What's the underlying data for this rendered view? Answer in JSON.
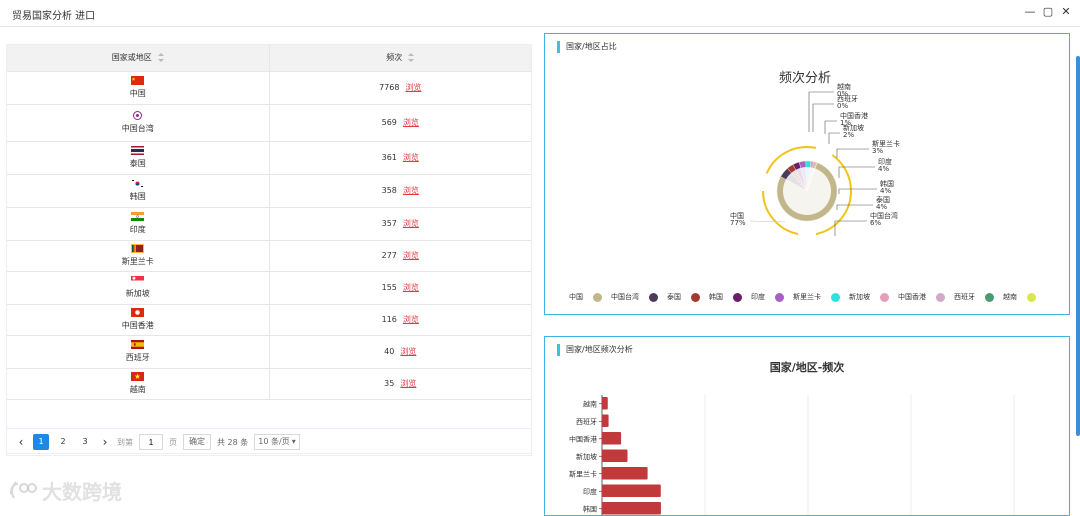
{
  "window": {
    "title": "贸易国家分析 进口"
  },
  "table": {
    "headers": [
      "国家或地区",
      "频次"
    ],
    "link_label": "浏览",
    "rows": [
      {
        "country": "中国",
        "count": "7768",
        "flag": "cn"
      },
      {
        "country": "中国台湾",
        "count": "569",
        "flag": "tw"
      },
      {
        "country": "泰国",
        "count": "361",
        "flag": "th"
      },
      {
        "country": "韩国",
        "count": "358",
        "flag": "kr"
      },
      {
        "country": "印度",
        "count": "357",
        "flag": "in"
      },
      {
        "country": "斯里兰卡",
        "count": "277",
        "flag": "lk"
      },
      {
        "country": "新加坡",
        "count": "155",
        "flag": "sg"
      },
      {
        "country": "中国香港",
        "count": "116",
        "flag": "hk"
      },
      {
        "country": "西班牙",
        "count": "40",
        "flag": "es"
      },
      {
        "country": "越南",
        "count": "35",
        "flag": "vn"
      }
    ]
  },
  "pagination": {
    "pages": [
      "1",
      "2",
      "3"
    ],
    "current": "1",
    "goto_label": "到第",
    "page_input": "1",
    "page_unit": "页",
    "confirm_label": "确定",
    "total_label": "共 28 条",
    "page_size": "10 条/页"
  },
  "watermark": "大数跨境",
  "pie_panel": {
    "title": "国家/地区占比",
    "chart_title": "频次分析"
  },
  "bar_panel": {
    "title": "国家/地区频次分析",
    "chart_title": "国家/地区-频次"
  },
  "chart_data": [
    {
      "type": "pie",
      "title": "频次分析",
      "slices": [
        {
          "label": "中国",
          "percent": "77%",
          "value": 7768,
          "color": "#c2b78a"
        },
        {
          "label": "中国台湾",
          "percent": "6%",
          "value": 569,
          "color": "#4b3a5a"
        },
        {
          "label": "泰国",
          "percent": "4%",
          "value": 361,
          "color": "#a23a32"
        },
        {
          "label": "韩国",
          "percent": "4%",
          "value": 358,
          "color": "#6b1e6b"
        },
        {
          "label": "印度",
          "percent": "4%",
          "value": 357,
          "color": "#a660c8"
        },
        {
          "label": "斯里兰卡",
          "percent": "3%",
          "value": 277,
          "color": "#2fe0e0"
        },
        {
          "label": "新加坡",
          "percent": "2%",
          "value": 155,
          "color": "#e4a0b8"
        },
        {
          "label": "中国香港",
          "percent": "1%",
          "value": 116,
          "color": "#d0aac8"
        },
        {
          "label": "西班牙",
          "percent": "0%",
          "value": 40,
          "color": "#4c9a72"
        },
        {
          "label": "越南",
          "percent": "0%",
          "value": 35,
          "color": "#d8e84c"
        }
      ],
      "legend_position": "bottom"
    },
    {
      "type": "bar",
      "orientation": "horizontal",
      "title": "国家/地区-频次",
      "categories": [
        "越南",
        "西班牙",
        "中国香港",
        "新加坡",
        "斯里兰卡",
        "印度",
        "韩国"
      ],
      "values": [
        35,
        40,
        116,
        155,
        277,
        357,
        358
      ],
      "color": "#c0393b",
      "grid": true
    }
  ]
}
